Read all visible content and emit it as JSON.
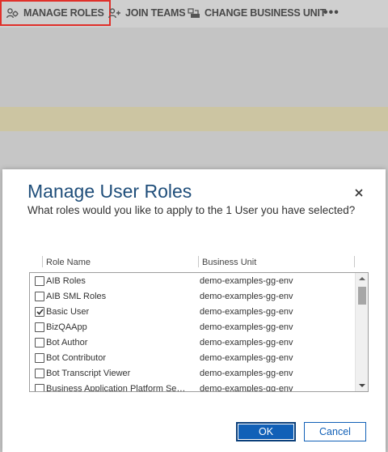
{
  "command_bar": {
    "manage_roles": "MANAGE ROLES",
    "join_teams": "JOIN TEAMS",
    "change_business_unit": "CHANGE BUSINESS UNIT",
    "more": "•••",
    "highlight_color": "#e0302a"
  },
  "dialog": {
    "title": "Manage User Roles",
    "subtitle": "What roles would you like to apply to the 1 User you have selected?",
    "close_icon": "close-icon",
    "columns": {
      "role_name": "Role Name",
      "business_unit": "Business Unit"
    },
    "rows": [
      {
        "name": "AIB Roles",
        "business_unit": "demo-examples-gg-env",
        "checked": false
      },
      {
        "name": "AIB SML Roles",
        "business_unit": "demo-examples-gg-env",
        "checked": false
      },
      {
        "name": "Basic User",
        "business_unit": "demo-examples-gg-env",
        "checked": true
      },
      {
        "name": "BizQAApp",
        "business_unit": "demo-examples-gg-env",
        "checked": false
      },
      {
        "name": "Bot Author",
        "business_unit": "demo-examples-gg-env",
        "checked": false
      },
      {
        "name": "Bot Contributor",
        "business_unit": "demo-examples-gg-env",
        "checked": false
      },
      {
        "name": "Bot Transcript Viewer",
        "business_unit": "demo-examples-gg-env",
        "checked": false
      },
      {
        "name": "Business Application Platform Se…",
        "business_unit": "demo-examples-gg-env",
        "checked": false
      }
    ],
    "ok_label": "OK",
    "cancel_label": "Cancel",
    "accent_color": "#1160b7"
  }
}
